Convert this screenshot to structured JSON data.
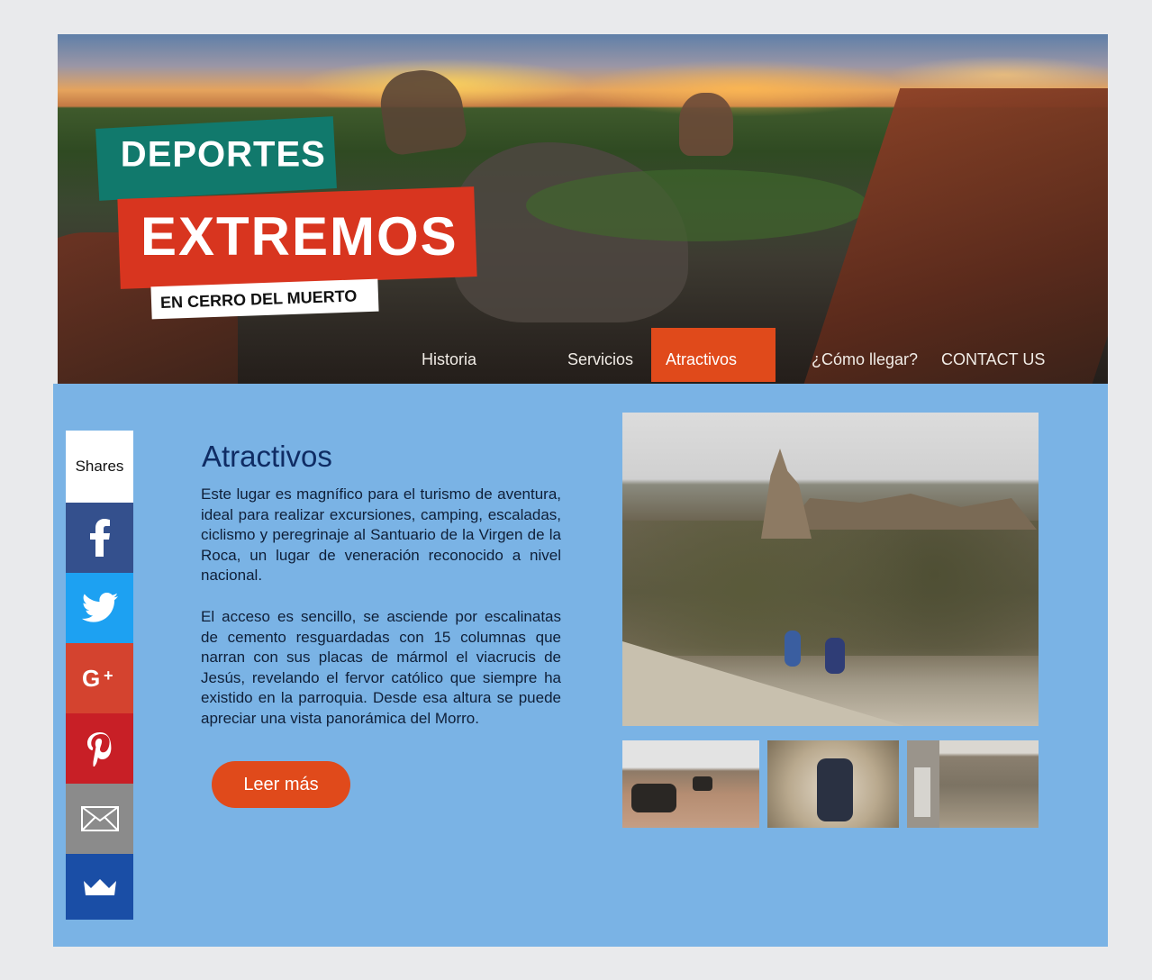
{
  "header": {
    "logo": {
      "line1": "DEPORTES",
      "line2": "EXTREMOS",
      "line3": "EN CERRO DEL MUERTO"
    },
    "nav": [
      {
        "label": "Historia",
        "active": false
      },
      {
        "label": "Servicios",
        "active": false
      },
      {
        "label": "Atractivos",
        "active": true
      },
      {
        "label": "¿Cómo llegar?",
        "active": false
      },
      {
        "label": "CONTACT US",
        "active": false
      }
    ]
  },
  "share_bar": {
    "label": "Shares",
    "items": [
      "facebook-icon",
      "twitter-icon",
      "google-plus-icon",
      "pinterest-icon",
      "email-icon",
      "crown-icon"
    ]
  },
  "content": {
    "title": "Atractivos",
    "paragraph1": "Este lugar es magnífico para el turismo de aventura, ideal para realizar excursiones, camping, escaladas, ciclismo y peregrinaje al Santuario de la Virgen de la Roca, un lugar de veneración reconocido a nivel nacional.",
    "paragraph2": "El acceso es sencillo, se asciende por escalinatas de cemento resguardadas con 15 columnas que narran con sus placas de mármol el viacrucis de Jesús, revelando el fervor católico que siempre ha existido en la parroquia. Desde esa altura se puede apreciar una vista panorámica del Morro.",
    "button": "Leer más"
  },
  "colors": {
    "accent": "#e04a1b",
    "panel": "#7ab3e5",
    "title": "#0f2c64",
    "facebook": "#34508d",
    "twitter": "#1da1f2",
    "google_plus": "#d4432f",
    "pinterest": "#c81f26",
    "email": "#8b8b8b",
    "crown": "#1a4ea6"
  }
}
